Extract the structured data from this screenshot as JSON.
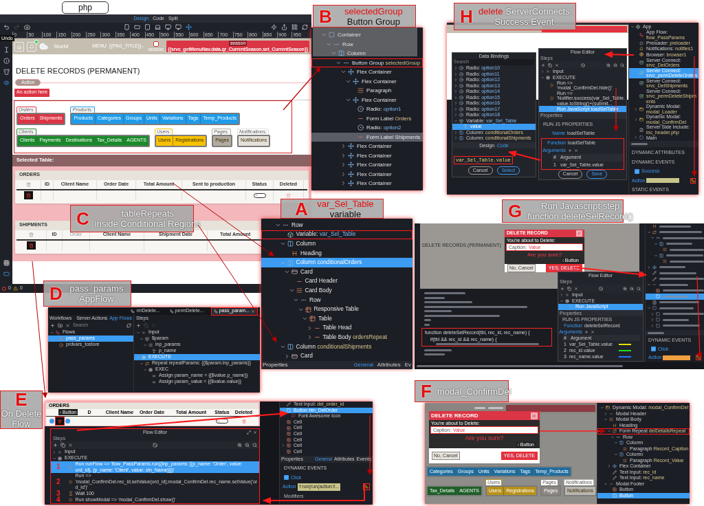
{
  "header_tab": "php",
  "editor": {
    "view_tabs": [
      {
        "label": "Design",
        "selected": true
      },
      {
        "label": "Code",
        "selected": false
      },
      {
        "label": "Split",
        "selected": false
      }
    ],
    "undo_tooltip": "Undo",
    "ruler": [
      "0",
      "50",
      "100",
      "150",
      "200",
      "250",
      "300",
      "350",
      "400",
      "450",
      "500",
      "550",
      "600",
      "650",
      "700",
      "750",
      "800",
      "850",
      "900",
      "950"
    ],
    "nav": {
      "brand": "StorM",
      "menu": "MENU",
      "page_title": "{{PAG_TITLE}}",
      "season_checked": false,
      "season_label": "season",
      "season_tag": "season",
      "season_value": "{{srvc_getMenuNav.data.qr_CurrentSeason.set_CurrentSeason}}"
    },
    "heading": "DELETE RECORDS (PERMANENT)",
    "action_tag": "Action",
    "action_button": "An action here",
    "group_rows": [
      [
        {
          "label": "Orders:",
          "color": "#dc3545",
          "buttons": [
            "Orders",
            "Shipments"
          ]
        },
        {
          "label": "Products:",
          "color": "#1e9bea",
          "buttons": [
            "Products",
            "Categories",
            "Groups",
            "Units",
            "Variations",
            "Tags",
            "Temp_Products"
          ]
        }
      ],
      [
        {
          "label": "Clients:",
          "color": "#198a2a",
          "buttons": [
            "Clients",
            "Payments",
            "Destinations",
            "Tax_Details",
            "AGENTS"
          ]
        },
        {
          "label": "Users:",
          "color": "#f7c100",
          "buttons": [
            "Users",
            "Registrations"
          ]
        },
        {
          "label": "Pages:",
          "color": "#b3ab9f",
          "buttons": [
            "Pages"
          ]
        },
        {
          "label": "Notifications:",
          "color": "#e4e0d9",
          "buttons": [
            "Notifications"
          ]
        }
      ]
    ],
    "selected_table_label": "Selected Table:",
    "tables": [
      {
        "title": "ORDERS",
        "columns": [
          {
            "kind": "action",
            "dimmed": false
          },
          {
            "label": "ID",
            "kind": "text",
            "dimmed": false
          },
          {
            "label": "Client Name",
            "kind": "text",
            "dimmed": false
          },
          {
            "label": "Order Date",
            "kind": "text",
            "dimmed": false
          },
          {
            "label": "Total Amount",
            "kind": "text",
            "dimmed": false
          },
          {
            "label": "Sent to production",
            "kind": "text",
            "dimmed": false
          },
          {
            "label": "Status",
            "kind": "toggle",
            "on": false,
            "dimmed": false
          },
          {
            "label": "Deleted",
            "kind": "trash",
            "dimmed": false
          }
        ]
      },
      {
        "title": "SHIPMENTS",
        "columns": [
          {
            "kind": "action",
            "dimmed": false
          },
          {
            "label": "ID",
            "kind": "text",
            "dimmed": false
          },
          {
            "label": "Order",
            "kind": "text",
            "dimmed": true
          },
          {
            "label": "Client Name",
            "kind": "text",
            "dimmed": false
          },
          {
            "label": "Shipment Date",
            "kind": "text",
            "dimmed": false
          },
          {
            "label": "Total Amount",
            "kind": "text",
            "dimmed": false
          }
        ]
      }
    ],
    "errors": "0",
    "warnings": "0"
  },
  "callout_c": {
    "letter": "C",
    "lines": [
      [
        {
          "text": "tableRepeats",
          "accent": false
        }
      ],
      [
        {
          "text": "inside Conditional Regions",
          "accent": false
        }
      ]
    ]
  },
  "callout_b": {
    "letter": "B",
    "lines": [
      [
        {
          "text": "selectedGroup",
          "accent": true
        }
      ],
      [
        {
          "text": "Button Group",
          "accent": false
        }
      ]
    ]
  },
  "tree_b": [
    {
      "label": "Container",
      "kind": "container",
      "expanded": true,
      "selected": false,
      "children": [
        {
          "label": "Row",
          "kind": "row",
          "expanded": true,
          "selected": false,
          "children": [
            {
              "label": "Column",
              "kind": "column",
              "expanded": true,
              "selected": false,
              "children": [
                {
                  "label": "Button Group",
                  "name": "selectedGroup",
                  "kind": "row",
                  "expanded": true,
                  "selected": false,
                  "annotated": true,
                  "children": [
                    {
                      "label": "Flex Container",
                      "kind": "flex",
                      "expanded": true,
                      "selected": false,
                      "children": [
                        {
                          "label": "Flex Container",
                          "kind": "flex",
                          "expanded": true,
                          "selected": false,
                          "children": [
                            {
                              "label": "Paragraph",
                              "kind": "paragraph",
                              "selected": false
                            }
                          ]
                        },
                        {
                          "label": "Flex Container",
                          "kind": "flex",
                          "expanded": true,
                          "selected": false,
                          "children": [
                            {
                              "label": "Radio:",
                              "name": "option1",
                              "kind": "radio",
                              "selected": false
                            },
                            {
                              "label": "Form Label",
                              "name": "Orders",
                              "kind": "label",
                              "selected": false
                            },
                            {
                              "label": "Radio:",
                              "name": "option2",
                              "kind": "radio",
                              "selected": false
                            },
                            {
                              "label": "Form Label",
                              "name": "Shipments",
                              "kind": "label",
                              "selected": true
                            }
                          ]
                        }
                      ]
                    },
                    {
                      "label": "Flex Container",
                      "kind": "flex",
                      "expanded": false,
                      "selected": false
                    },
                    {
                      "label": "Flex Container",
                      "kind": "flex",
                      "expanded": false,
                      "selected": false
                    },
                    {
                      "label": "Flex Container",
                      "kind": "flex",
                      "expanded": false,
                      "selected": false
                    },
                    {
                      "label": "Flex Container",
                      "kind": "flex",
                      "expanded": false,
                      "selected": false
                    },
                    {
                      "label": "Flex Container",
                      "kind": "flex",
                      "expanded": false,
                      "selected": false
                    }
                  ]
                }
              ]
            }
          ]
        }
      ]
    }
  ],
  "callout_a": {
    "letter": "A",
    "lines": [
      [
        {
          "text": "var_Sel_Table",
          "accent": true
        }
      ],
      [
        {
          "text": "variable",
          "accent": false
        }
      ]
    ]
  },
  "tree_a": {
    "items": [
      {
        "label": "Row",
        "kind": "row",
        "expanded": true,
        "selected": false,
        "children": [
          {
            "label": "Variable:",
            "name": "var_Sel_Table",
            "kind": "variable",
            "selected": false,
            "annotated": true
          },
          {
            "label": "Column",
            "kind": "column",
            "expanded": true,
            "selected": false,
            "children": [
              {
                "label": "Heading",
                "kind": "heading",
                "selected": false
              }
            ]
          },
          {
            "label": "Column",
            "name": "conditionalOrders",
            "kind": "column",
            "expanded": true,
            "selected": true,
            "children": [
              {
                "label": "Card",
                "kind": "card",
                "expanded": true,
                "selected": false,
                "children": [
                  {
                    "label": "Card Header",
                    "kind": "label",
                    "selected": false
                  },
                  {
                    "label": "Card Body",
                    "kind": "paragraph",
                    "expanded": true,
                    "selected": false,
                    "children": [
                      {
                        "label": "Row",
                        "kind": "row",
                        "expanded": true,
                        "selected": false,
                        "children": [
                          {
                            "label": "Responsive Table",
                            "kind": "table",
                            "expanded": true,
                            "selected": false,
                            "children": [
                              {
                                "label": "Table",
                                "kind": "table",
                                "expanded": true,
                                "selected": false,
                                "children": [
                                  {
                                    "label": "Table Head",
                                    "kind": "label",
                                    "expanded": false,
                                    "selected": false
                                  },
                                  {
                                    "label": "Table Body",
                                    "name": "ordersRepeat",
                                    "kind": "label",
                                    "expanded": false,
                                    "selected": false
                                  }
                                ]
                              }
                            ]
                          }
                        ]
                      }
                    ]
                  }
                ]
              }
            ]
          },
          {
            "label": "Column",
            "name": "conditionalShipments",
            "kind": "column",
            "expanded": true,
            "selected": false,
            "children": [
              {
                "label": "Card",
                "kind": "card",
                "expanded": false,
                "selected": false
              }
            ]
          }
        ]
      }
    ],
    "footer_title": "Properties",
    "footer_tabs": [
      {
        "label": "General",
        "selected": true
      },
      {
        "label": "Attributes",
        "selected": false
      },
      {
        "label": "Ev",
        "selected": false
      }
    ]
  },
  "callout_d": {
    "letter": "D",
    "lines": [
      [
        {
          "text": "pass_params",
          "accent": false
        }
      ],
      [
        {
          "text": "AppFlow",
          "accent": false
        }
      ]
    ]
  },
  "panel_d": {
    "tabs": [
      {
        "label": "rmDelete...",
        "selected": false
      },
      {
        "label": "permDelete...",
        "selected": false
      },
      {
        "label": "pass_param...",
        "selected": true
      }
    ],
    "workflows_title": "Workflows",
    "source_tabs": [
      {
        "label": "Server Actions",
        "selected": false
      },
      {
        "label": "App Flows",
        "selected": true
      }
    ],
    "search_placeholder": "Search",
    "flows": [
      {
        "label": "Flows",
        "kind": "flow",
        "expanded": true,
        "selected": false,
        "children": [
          {
            "label": "pass_params",
            "kind": "flowitem",
            "selected": true
          },
          {
            "label": "prdvars_tostore",
            "kind": "flowitem",
            "selected": false
          }
        ]
      }
    ],
    "steps_title": "Steps",
    "steps": [
      {
        "label": "Input",
        "kind": "chevrons",
        "expanded": true,
        "selected": false,
        "children": [
          {
            "label": "$param",
            "kind": "object",
            "expanded": true,
            "selected": false,
            "children": [
              {
                "label": "inp_params",
                "kind": "array",
                "expanded": true,
                "selected": false,
                "children": [
                  {
                    "label": "p_name",
                    "kind": "text",
                    "selected": false
                  }
                ]
              }
            ]
          }
        ]
      },
      {
        "label": "EXECUTE",
        "kind": "execute",
        "expanded": true,
        "selected": true,
        "children": [
          {
            "label": "Repeat repeatParams: {{$param.inp_params}}",
            "kind": "repeat",
            "expanded": true,
            "selected": false,
            "children": [
              {
                "label": "EXEC",
                "kind": "execute",
                "expanded": true,
                "selected": false,
                "children": [
                  {
                    "label": "Assign param_name = {{$value.p_name}}",
                    "kind": "assign",
                    "selected": false
                  },
                  {
                    "label": "Assign param_value = {{$value.value}}",
                    "kind": "assign",
                    "selected": false
                  }
                ]
              }
            ]
          }
        ]
      }
    ]
  },
  "callout_e": {
    "letter": "E",
    "lines": [
      [
        {
          "text": "On Delete",
          "accent": false
        }
      ],
      [
        {
          "text": "Flow",
          "accent": false
        }
      ]
    ]
  },
  "panel_e": {
    "table_title": "ORDERS",
    "columns": [
      {
        "label": "D",
        "kind": "text"
      },
      {
        "label": "Client Name",
        "kind": "text"
      },
      {
        "label": "Order Date",
        "kind": "text"
      },
      {
        "label": "Total Amount",
        "kind": "text"
      },
      {
        "label": "Status",
        "kind": "toggle",
        "on": false
      },
      {
        "label": "Deleted",
        "kind": "trash"
      }
    ],
    "tooltip": "Button",
    "tree": [
      {
        "label": "Text Input:",
        "name": "del_order_id",
        "kind": "input",
        "selected": false
      },
      {
        "label": "Button",
        "name": "btn_DelOrder",
        "kind": "button",
        "expanded": true,
        "selected": true,
        "children": [
          {
            "label": "Font Awesome Icon",
            "kind": "fa",
            "selected": false
          }
        ]
      },
      {
        "label": "Cell",
        "kind": "cell",
        "selected": false
      },
      {
        "label": "Cell",
        "kind": "cell",
        "selected": false
      },
      {
        "label": "Cell",
        "kind": "cell",
        "selected": false
      },
      {
        "label": "Cell",
        "kind": "cell",
        "selected": false
      },
      {
        "label": "Cell",
        "kind": "cell",
        "expanded": false,
        "selected": false
      },
      {
        "label": "Cell",
        "kind": "cell",
        "selected": false
      }
    ],
    "properties_title": "Properties",
    "property_tabs": [
      {
        "label": "General",
        "selected": true
      },
      {
        "label": "Attributes",
        "selected": false
      },
      {
        "label": "Events",
        "selected": false
      }
    ],
    "events_title": "DYNAMIC EVENTS",
    "event": {
      "label": "Click",
      "checked": true
    },
    "action_label": "Action",
    "action_value": "f run(run(action:f...",
    "modifiers_label": "Modifiers",
    "flow_title": "Flow Editor",
    "steps_label": "Steps",
    "steps": [
      {
        "label": "Input",
        "kind": "chevrons",
        "expanded": false,
        "selected": false
      },
      {
        "label": "EXECUTE",
        "kind": "execute",
        "expanded": true,
        "selected": false,
        "children": [
          {
            "number": "1",
            "label": "Run runFlow => 'flow_PassParams.run({inp_params: [{p_name: 'Order', value: ord_id}, {p_name: 'Client', value: cln_Name}]})'",
            "kind": "run",
            "selected": true
          },
          {
            "number": "2",
            "label": "Run => 'modal_ConfirmDel.rec_id.setValue(ord_id);modal_ConfirmDel.rec_name.setValue('ord_id')'",
            "kind": "run",
            "selected": false
          },
          {
            "number": "3",
            "label": "Wait 100",
            "kind": "wait",
            "selected": false
          },
          {
            "number": "4",
            "label": "Run showModal => 'modal_ConfirmDel.show()'",
            "kind": "run",
            "selected": false
          }
        ]
      }
    ]
  },
  "callout_h": {
    "letter": "H",
    "lines": [
      [
        {
          "text": "delete",
          "accent": true
        },
        {
          "text": "ServerConnects",
          "accent": false
        }
      ],
      [
        {
          "text": "Success Event",
          "accent": false
        }
      ]
    ]
  },
  "panel_h": {
    "bindings_title": "Data Bindings",
    "search_placeholder": "Search",
    "bindings": [
      {
        "label": "Radio:",
        "name": "option10",
        "kind": "radio",
        "expanded": false,
        "selected": false
      },
      {
        "label": "Radio:",
        "name": "option11",
        "kind": "radio",
        "expanded": false,
        "selected": false
      },
      {
        "label": "Radio:",
        "name": "option12",
        "kind": "radio",
        "expanded": false,
        "selected": false
      },
      {
        "label": "Radio:",
        "name": "option13",
        "kind": "radio",
        "expanded": false,
        "selected": false
      },
      {
        "label": "Radio:",
        "name": "option14",
        "kind": "radio",
        "expanded": false,
        "selected": false
      },
      {
        "label": "Radio:",
        "name": "option15",
        "kind": "radio",
        "expanded": false,
        "selected": false
      },
      {
        "label": "Radio:",
        "name": "option16",
        "kind": "radio",
        "expanded": false,
        "selected": false
      },
      {
        "label": "Radio:",
        "name": "option17",
        "kind": "radio",
        "expanded": false,
        "selected": false
      },
      {
        "label": "Radio:",
        "name": "option18",
        "kind": "radio",
        "expanded": false,
        "selected": false
      },
      {
        "label": "Variable:",
        "name": "var_Sel_Table",
        "kind": "variable",
        "expanded": true,
        "selected": false,
        "children": [
          {
            "label": "value",
            "kind": "text",
            "selected": true
          }
        ]
      },
      {
        "label": "Column:",
        "name": "conditionalOrders",
        "kind": "column",
        "expanded": false,
        "selected": false
      },
      {
        "label": "Column:",
        "name": "conditionalShipments",
        "kind": "column",
        "expanded": false,
        "selected": false
      }
    ],
    "editor_tabs": [
      {
        "label": "Design",
        "selected": false
      },
      {
        "label": "Code",
        "selected": true
      }
    ],
    "expression": "var_Sel_Table.value",
    "bindings_buttons": [
      "Cancel",
      "Select"
    ],
    "flow_title": "Flow Editor",
    "steps_label": "Steps",
    "steps": [
      {
        "label": "Input",
        "kind": "chevrons",
        "expanded": false,
        "selected": false
      },
      {
        "label": "EXECUTE",
        "kind": "execute",
        "expanded": true,
        "selected": false,
        "children": [
          {
            "label": "Run => 'modal_ConfirmDel.hide()'",
            "kind": "run",
            "selected": false
          },
          {
            "label": "Run => 'Notifier.success(var_Sel_Table.value.toString()+(submit...",
            "kind": "run",
            "selected": false
          },
          {
            "label": "Run JavaScript loadSelTable",
            "kind": "js",
            "selected": true
          }
        ]
      }
    ],
    "properties_label": "Properties",
    "js_title": "RUN JS PROPERTIES",
    "name_label": "Name",
    "name_value": "loadSelTable",
    "function_label": "Function",
    "function_value": "loadSelTable",
    "arguments_label": "Arguments",
    "arg_header": [
      "#",
      "Argument"
    ],
    "args": [
      {
        "n": "1",
        "value": "var_Sel_Table.value"
      }
    ],
    "flow_buttons": [
      "Cancel",
      "Save"
    ],
    "tree": [
      {
        "label": "App",
        "kind": "app",
        "expanded": true,
        "selected": false,
        "children": [
          {
            "label": "App Flow:",
            "name": "flow_PassParams",
            "kind": "flow",
            "selected": false
          },
          {
            "label": "Preloader:",
            "name": "preloader",
            "kind": "preloader",
            "selected": false
          },
          {
            "label": "Notifications:",
            "name": "notifies1",
            "kind": "bell",
            "selected": false
          },
          {
            "label": "Browser:",
            "name": "browser1",
            "kind": "browser",
            "selected": false
          },
          {
            "label": "Server Connect:",
            "name": "srvc_DelOrders",
            "kind": "server",
            "selected": false
          },
          {
            "label": "Server Connect:",
            "name": "srvc_permDeleteOrders",
            "kind": "server",
            "selected": true
          },
          {
            "label": "Server Connect:",
            "name": "srvc_DelShipments",
            "kind": "server",
            "selected": false
          },
          {
            "label": "Server Connect:",
            "name": "srvc_permDeleteShipments",
            "kind": "server",
            "selected": false
          },
          {
            "label": "Dynamic Modal:",
            "name": "modal_Loader",
            "kind": "modal",
            "expanded": false,
            "selected": false
          },
          {
            "label": "Dynamic Modal:",
            "name": "modal_ConfirmDel",
            "kind": "modal",
            "expanded": false,
            "selected": false
          },
          {
            "label": "Server Side Include:",
            "name": "inc_header.php",
            "kind": "include",
            "selected": false
          },
          {
            "label": "Main",
            "kind": "container",
            "expanded": false,
            "selected": false
          }
        ]
      }
    ],
    "attributes_title": "DYNAMIC ATTRIBUTES",
    "events_title": "DYNAMIC EVENTS",
    "event": {
      "label": "Success",
      "checked": true
    },
    "action_label": "Action",
    "static_title": "STATIC EVENTS"
  },
  "callout_g": {
    "letter": "G",
    "lines": [
      [
        {
          "text": "Run Javascript step",
          "accent": false
        }
      ],
      [
        {
          "text": "function deleteSelRecord()",
          "accent": false
        }
      ]
    ]
  },
  "panel_g": {
    "heading": "DELETE RECORDS (PERMANENT)",
    "modal": {
      "title": "DELETE RECORD",
      "intro": "You're about to Delete:",
      "caption": "Caption:",
      "value": "Value",
      "question": "Are you sure?",
      "tooltip": "Button",
      "cancel": "No, Cancel",
      "confirm": "YES, DELETE"
    },
    "code_highlight": [
      "function deleteSelRecord(tbl, rec_id, rec_name) {",
      "if(tbl && rec_id && rec_name) {"
    ],
    "flow_title": "Flow Editor",
    "steps_label": "Steps",
    "steps": [
      {
        "label": "Input",
        "kind": "chevrons",
        "expanded": false,
        "selected": false
      },
      {
        "label": "EXECUTE",
        "kind": "execute",
        "expanded": true,
        "selected": false,
        "children": [
          {
            "label": "Run JavaScript",
            "kind": "js",
            "selected": true
          }
        ]
      }
    ],
    "properties_label": "Properties",
    "js_title": "RUN JS PROPERTIES",
    "function_label": "Function",
    "function_value": "deleteSelRecord",
    "arguments_label": "Arguments",
    "arg_header": [
      "#",
      "Argument"
    ],
    "args": [
      {
        "n": "1",
        "value": "var_Sel_Table.value",
        "color": "#e5e000"
      },
      {
        "n": "2",
        "value": "rec_id.value",
        "color": "#22dd22"
      },
      {
        "n": "3",
        "value": "rec_name.value",
        "color": "#2277ff"
      }
    ],
    "tree": [
      {
        "kind": "heading",
        "selected": false
      },
      {
        "kind": "repeat",
        "expanded": true,
        "selected": false,
        "children": [
          {
            "kind": "row",
            "expanded": true,
            "selected": false,
            "children": [
              {
                "kind": "column",
                "expanded": true,
                "selected": false,
                "children": [
                  {
                    "kind": "paragraph",
                    "selected": false
                  }
                ]
              },
              {
                "kind": "column",
                "expanded": true,
                "selected": false,
                "children": [
                  {
                    "kind": "paragraph",
                    "selected": false
                  }
                ]
              }
            ]
          }
        ]
      },
      {
        "kind": "flex",
        "expanded": false,
        "selected": false
      },
      {
        "kind": "input",
        "selected": false
      },
      {
        "kind": "input",
        "selected": false
      },
      {
        "kind": "label",
        "expanded": true,
        "selected": false,
        "children": [
          {
            "kind": "cell",
            "selected": false
          },
          {
            "kind": "button",
            "selected": true
          }
        ]
      },
      {
        "kind": "include",
        "selected": false
      },
      {
        "kind": "container",
        "expanded": true,
        "selected": false,
        "children": [
          {
            "kind": "container",
            "expanded": false,
            "selected": false
          },
          {
            "kind": "container",
            "expanded": false,
            "selected": false
          },
          {
            "kind": "container",
            "expanded": false,
            "selected": false
          }
        ]
      }
    ],
    "events_title": "DYNAMIC EVENTS",
    "event": {
      "label": "Click",
      "checked": true
    },
    "action_label": "Action"
  },
  "callout_f": {
    "letter": "F",
    "lines": [
      [
        {
          "text": "modal_ConfirmDel",
          "accent": false
        }
      ]
    ]
  },
  "panel_f": {
    "modal": {
      "title": "DELETE RECORD",
      "intro": "You're about to Delete:",
      "caption": "Caption:",
      "value": "Value",
      "question": "Are you sure?",
      "tooltip": "Button",
      "cancel": "No, Cancel",
      "confirm": "YES, DELETE"
    },
    "group_rows": [
      [
        {
          "color": "#1f6d9e",
          "buttons": [
            "Categories",
            "Groups",
            "Units",
            "Variations",
            "Tags",
            "Temp_Products"
          ]
        }
      ],
      [
        {
          "color": "#1d5f26",
          "buttons": [
            "Tax_Details",
            "AGENTS"
          ]
        },
        {
          "label": "Users",
          "color": "#b8911a",
          "buttons": [
            "Users",
            "Registrations"
          ]
        },
        {
          "label": "Pages",
          "color": "#8c8781",
          "buttons": [
            "Pages"
          ]
        },
        {
          "label": "Notifications",
          "color": "#b9b5af",
          "buttons": [
            "Notifications"
          ]
        }
      ]
    ],
    "tree": [
      {
        "label": "Dynamic Modal:",
        "name": "modal_ConfirmDel",
        "kind": "modal",
        "expanded": true,
        "selected": false,
        "children": [
          {
            "label": "Modal Header",
            "kind": "label",
            "expanded": false,
            "selected": false
          },
          {
            "label": "Modal Body",
            "kind": "paragraph",
            "expanded": true,
            "selected": false,
            "children": [
              {
                "label": "Heading",
                "kind": "heading",
                "selected": false
              },
              {
                "label": "Form Repeat",
                "name": "delDetailsRepeat",
                "kind": "repeat",
                "expanded": true,
                "selected": false,
                "annotated": true,
                "children": [
                  {
                    "label": "Row",
                    "kind": "row",
                    "expanded": true,
                    "selected": false,
                    "children": [
                      {
                        "label": "Column",
                        "kind": "column",
                        "expanded": true,
                        "selected": false,
                        "children": [
                          {
                            "label": "Paragraph",
                            "name": "Record_Caption",
                            "kind": "paragraph",
                            "selected": false
                          }
                        ]
                      },
                      {
                        "label": "Column",
                        "kind": "column",
                        "expanded": true,
                        "selected": false,
                        "children": [
                          {
                            "label": "Paragraph",
                            "name": "Record_Value",
                            "kind": "paragraph",
                            "selected": false
                          }
                        ]
                      }
                    ]
                  }
                ]
              },
              {
                "label": "Flex Container",
                "kind": "flex",
                "expanded": false,
                "selected": false
              },
              {
                "label": "Text Input:",
                "name": "rec_id",
                "kind": "input",
                "selected": false
              },
              {
                "label": "Text Input:",
                "name": "rec_name",
                "kind": "input",
                "selected": false
              }
            ]
          },
          {
            "label": "Modal Footer",
            "kind": "label",
            "expanded": true,
            "selected": false,
            "children": [
              {
                "label": "Button",
                "kind": "cell",
                "selected": false
              },
              {
                "label": "Button",
                "kind": "button",
                "selected": true
              }
            ]
          }
        ]
      }
    ]
  }
}
